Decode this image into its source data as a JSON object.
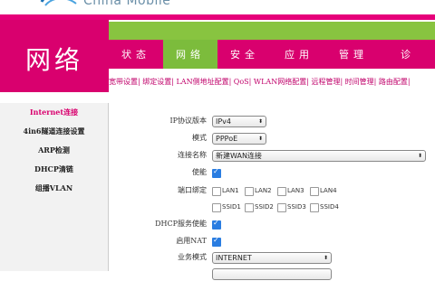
{
  "brand": {
    "logo_text": "China Mobile"
  },
  "header": {
    "section_title": "网络"
  },
  "nav": {
    "tabs": [
      "状态",
      "网络",
      "安全",
      "应用",
      "管理",
      "诊"
    ]
  },
  "subnav": {
    "text": "宽带设置| 绑定设置| LAN侧地址配置| QoS| WLAN网络配置| 远程管理| 时间管理| 路由配置|"
  },
  "sidebar": {
    "items": [
      "Internet连接",
      "4in6隧道连接设置",
      "ARP检测",
      "DHCP清链",
      "组播VLAN"
    ]
  },
  "form": {
    "ip_version": {
      "label": "IP协议版本",
      "value": "IPv4"
    },
    "mode": {
      "label": "模式",
      "value": "PPPoE"
    },
    "conn_name": {
      "label": "连接名称",
      "value": "新建WAN连接"
    },
    "enable": {
      "label": "使能",
      "checked": true
    },
    "port_bind": {
      "label": "端口绑定",
      "options": [
        "LAN1",
        "LAN2",
        "LAN3",
        "LAN4",
        "SSID1",
        "SSID2",
        "SSID3",
        "SSID4"
      ]
    },
    "dhcp": {
      "label": "DHCP服务使能",
      "checked": true
    },
    "nat": {
      "label": "启用NAT",
      "checked": true
    },
    "service_mode": {
      "label": "业务模式",
      "value": "INTERNET"
    }
  },
  "colors": {
    "magenta": "#d9006e",
    "green": "#7cbc3c",
    "check_blue": "#2a7de1"
  }
}
